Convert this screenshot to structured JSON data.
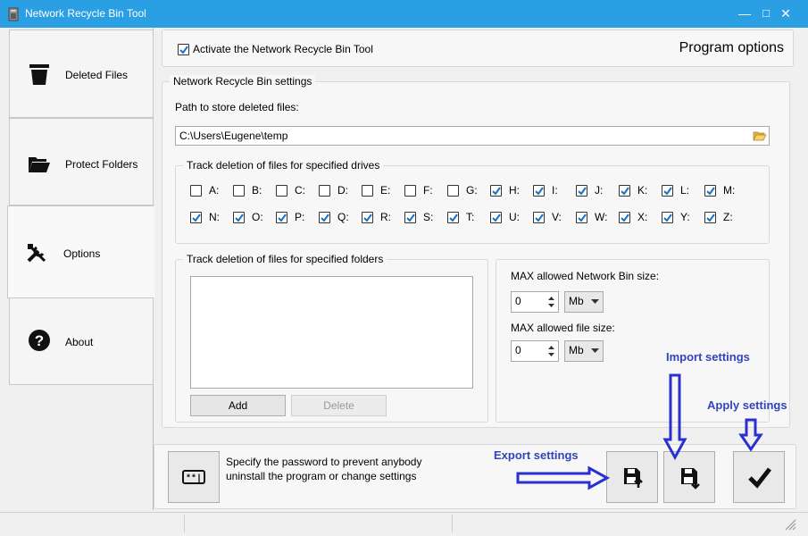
{
  "window": {
    "title": "Network Recycle Bin Tool",
    "minimize": "—",
    "maximize": "□",
    "close": "✕"
  },
  "nav": {
    "items": [
      {
        "label": "Deleted Files",
        "icon": "trash-icon"
      },
      {
        "label": "Protect Folders",
        "icon": "folder-open-icon"
      },
      {
        "label": "Options",
        "icon": "tools-icon",
        "active": true
      },
      {
        "label": "About",
        "icon": "help-icon"
      }
    ]
  },
  "options": {
    "activate_label": "Activate the Network Recycle Bin Tool",
    "activate_checked": true,
    "heading": "Program options",
    "settings_group": "Network Recycle Bin settings",
    "path_label": "Path to store deleted files:",
    "path_value": "C:\\Users\\Eugene\\temp",
    "drives_group": "Track deletion of files for specified drives",
    "drives": [
      {
        "label": "A:",
        "checked": false
      },
      {
        "label": "B:",
        "checked": false
      },
      {
        "label": "C:",
        "checked": false
      },
      {
        "label": "D:",
        "checked": false
      },
      {
        "label": "E:",
        "checked": false
      },
      {
        "label": "F:",
        "checked": false
      },
      {
        "label": "G:",
        "checked": false
      },
      {
        "label": "H:",
        "checked": true
      },
      {
        "label": "I:",
        "checked": true
      },
      {
        "label": "J:",
        "checked": true
      },
      {
        "label": "K:",
        "checked": true
      },
      {
        "label": "L:",
        "checked": true
      },
      {
        "label": "M:",
        "checked": true
      },
      {
        "label": "N:",
        "checked": true
      },
      {
        "label": "O:",
        "checked": true
      },
      {
        "label": "P:",
        "checked": true
      },
      {
        "label": "Q:",
        "checked": true
      },
      {
        "label": "R:",
        "checked": true
      },
      {
        "label": "S:",
        "checked": true
      },
      {
        "label": "T:",
        "checked": true
      },
      {
        "label": "U:",
        "checked": true
      },
      {
        "label": "V:",
        "checked": true
      },
      {
        "label": "W:",
        "checked": true
      },
      {
        "label": "X:",
        "checked": true
      },
      {
        "label": "Y:",
        "checked": true
      },
      {
        "label": "Z:",
        "checked": true
      }
    ],
    "folders_group": "Track deletion of files for specified folders",
    "add_label": "Add",
    "delete_label": "Delete",
    "max_bin_label": "MAX allowed Network Bin size:",
    "max_bin_value": "0",
    "max_bin_unit": "Mb",
    "max_file_label": "MAX allowed file size:",
    "max_file_value": "0",
    "max_file_unit": "Mb"
  },
  "footer": {
    "password_text_1": "Specify the password to prevent anybody",
    "password_text_2": "uninstall the program or change settings",
    "password_icon": "password-icon",
    "export_annotation": "Export settings",
    "import_annotation": "Import settings",
    "apply_annotation": "Apply settings",
    "annotation_color": "#3344bb"
  },
  "colors": {
    "titlebar": "#2b9fe3"
  }
}
